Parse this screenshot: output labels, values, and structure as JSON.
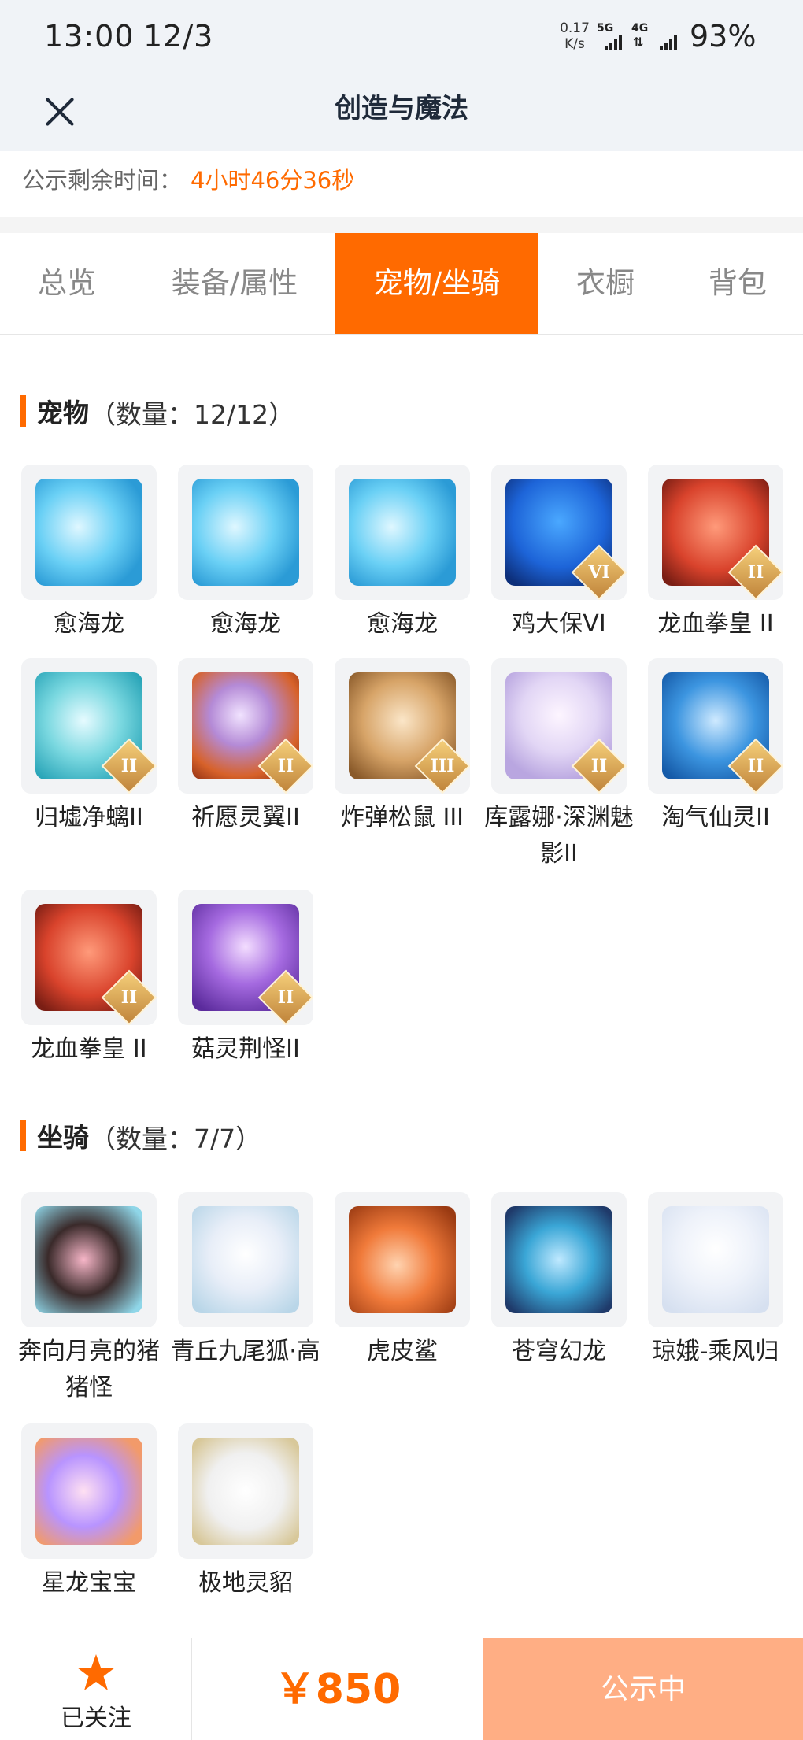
{
  "status_bar": {
    "time": "13:00",
    "date": "12/3",
    "net_speed": "0.17\nK/s",
    "net_5g": "5G",
    "net_4g": "4G",
    "battery": "93%"
  },
  "header": {
    "title": "创造与魔法",
    "close_icon": "close-icon"
  },
  "notice": {
    "label": "公示剩余时间：",
    "remaining": "4小时46分36秒"
  },
  "tabs": [
    {
      "label": "总览",
      "active": false
    },
    {
      "label": "装备/属性",
      "active": false
    },
    {
      "label": "宠物/坐骑",
      "active": true
    },
    {
      "label": "衣橱",
      "active": false
    },
    {
      "label": "背包",
      "active": false
    }
  ],
  "pets": {
    "title": "宠物",
    "count": "（数量：12/12）",
    "items": [
      {
        "name": "愈海龙",
        "badge": ""
      },
      {
        "name": "愈海龙",
        "badge": ""
      },
      {
        "name": "愈海龙",
        "badge": ""
      },
      {
        "name": "鸡大保VI",
        "badge": "VI"
      },
      {
        "name": "龙血拳皇 II",
        "badge": "II"
      },
      {
        "name": "归墟净螭II",
        "badge": "II"
      },
      {
        "name": "祈愿灵翼II",
        "badge": "II"
      },
      {
        "name": "炸弹松鼠 III",
        "badge": "III"
      },
      {
        "name": "库露娜·深渊魅影II",
        "badge": "II"
      },
      {
        "name": "淘气仙灵II",
        "badge": "II"
      },
      {
        "name": "龙血拳皇 II",
        "badge": "II"
      },
      {
        "name": "菇灵荆怪II",
        "badge": "II"
      }
    ]
  },
  "mounts": {
    "title": "坐骑",
    "count": "（数量：7/7）",
    "items": [
      {
        "name": "奔向月亮的猪猪怪"
      },
      {
        "name": "青丘九尾狐·高"
      },
      {
        "name": "虎皮鲨"
      },
      {
        "name": "苍穹幻龙"
      },
      {
        "name": "琼娥-乘风归"
      },
      {
        "name": "星龙宝宝"
      },
      {
        "name": "极地灵貂"
      }
    ]
  },
  "footer": {
    "follow_label": "已关注",
    "price": "￥850",
    "status_label": "公示中"
  },
  "colors": {
    "accent": "#ff6a00",
    "status_button": "#ffae84",
    "header_bg": "#f0f3f7"
  }
}
